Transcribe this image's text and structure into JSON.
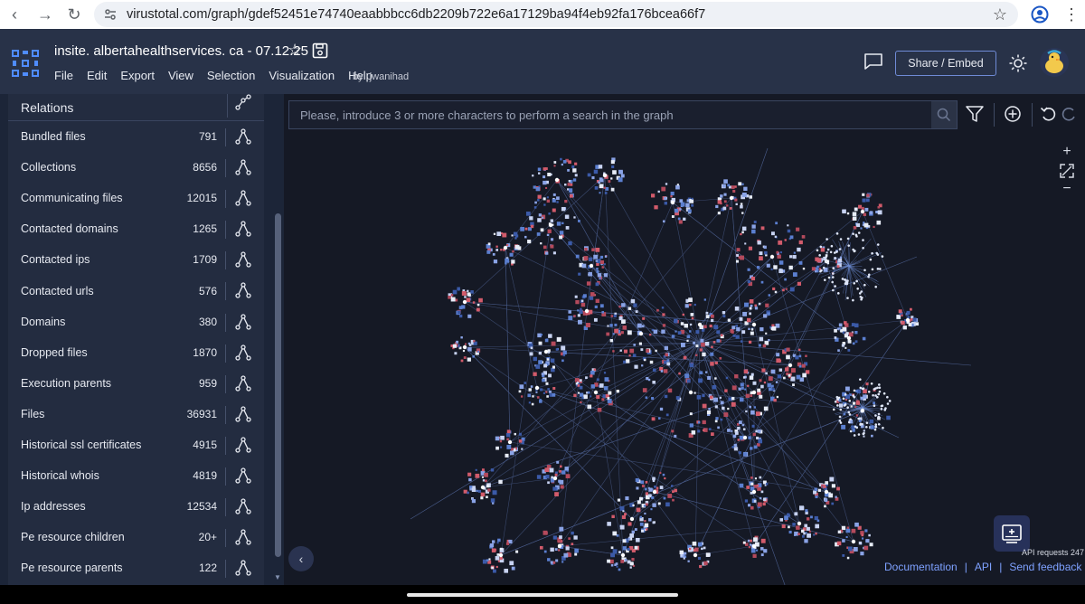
{
  "browser": {
    "url": "virustotal.com/graph/gdef52451e74740eaabbbcc6db2209b722e6a17129ba94f4eb92fa176bcea66f7"
  },
  "app": {
    "title": "insite. albertahealthservices. ca - 07.12.25",
    "menu": [
      "File",
      "Edit",
      "Export",
      "View",
      "Selection",
      "Visualization",
      "Help"
    ],
    "by_label": "by",
    "author": "jwanihad",
    "share_label": "Share / Embed"
  },
  "sidebar": {
    "header": "Relations",
    "items": [
      {
        "label": "Bundled files",
        "count": "791"
      },
      {
        "label": "Collections",
        "count": "8656"
      },
      {
        "label": "Communicating files",
        "count": "12015"
      },
      {
        "label": "Contacted domains",
        "count": "1265"
      },
      {
        "label": "Contacted ips",
        "count": "1709"
      },
      {
        "label": "Contacted urls",
        "count": "576"
      },
      {
        "label": "Domains",
        "count": "380"
      },
      {
        "label": "Dropped files",
        "count": "1870"
      },
      {
        "label": "Execution parents",
        "count": "959"
      },
      {
        "label": "Files",
        "count": "36931"
      },
      {
        "label": "Historical ssl certificates",
        "count": "4915"
      },
      {
        "label": "Historical whois",
        "count": "4819"
      },
      {
        "label": "Ip addresses",
        "count": "12534"
      },
      {
        "label": "Pe resource children",
        "count": "20+"
      },
      {
        "label": "Pe resource parents",
        "count": "122"
      }
    ]
  },
  "graph": {
    "search_placeholder": "Please, introduce 3 or more characters to perform a search in the graph",
    "api_requests": "API requests 247",
    "footer": {
      "documentation": "Documentation",
      "api": "API",
      "feedback": "Send feedback"
    }
  },
  "colors": {
    "header_bg": "#283248",
    "graph_bg": "#151925",
    "accent": "#7ea1ff",
    "node": "#5b7fd0"
  }
}
